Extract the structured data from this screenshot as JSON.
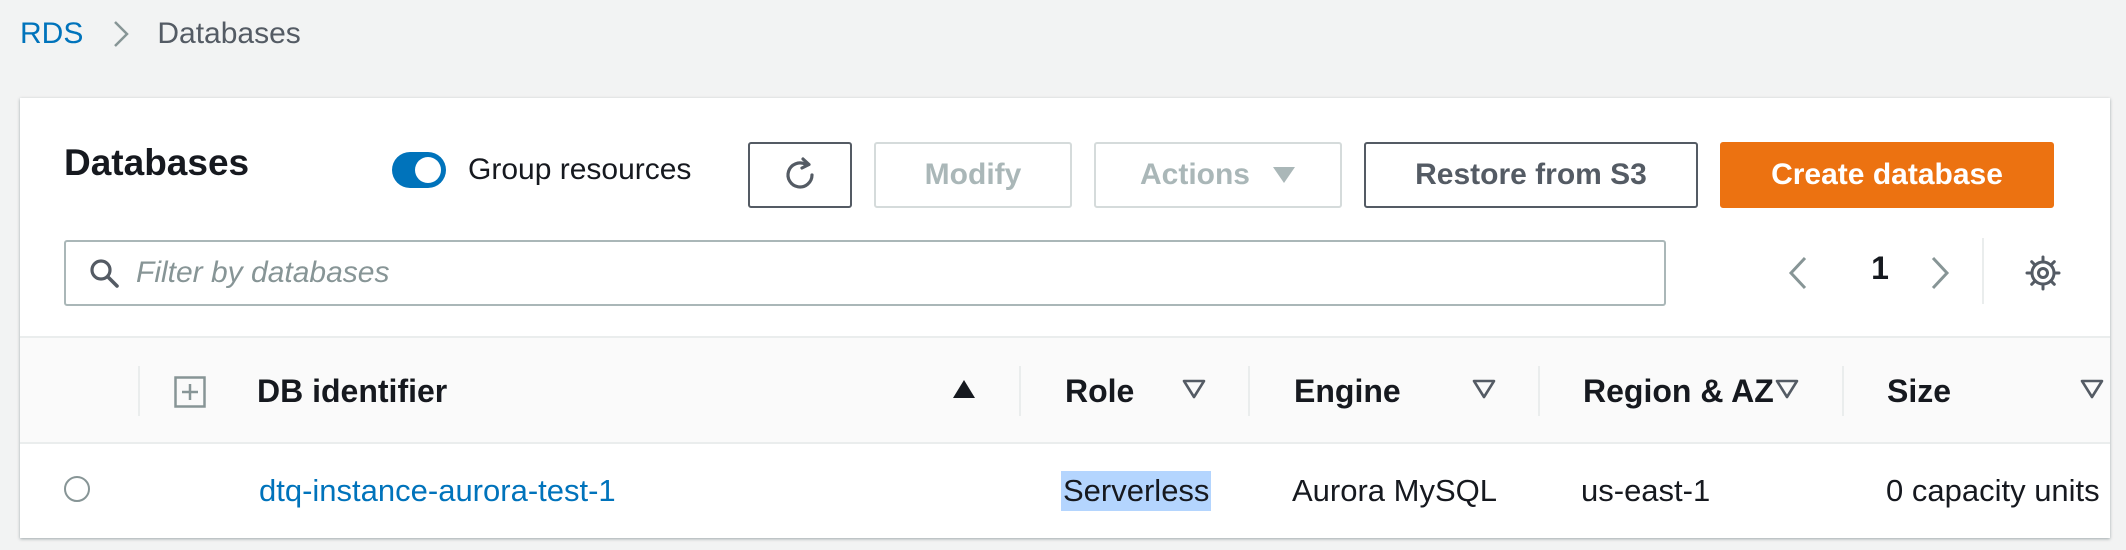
{
  "breadcrumb": {
    "root": "RDS",
    "current": "Databases"
  },
  "panel": {
    "title": "Databases"
  },
  "toolbar": {
    "group_resources_label": "Group resources",
    "group_resources_on": true,
    "modify_label": "Modify",
    "actions_label": "Actions",
    "restore_label": "Restore from S3",
    "create_label": "Create database"
  },
  "filter": {
    "placeholder": "Filter by databases",
    "value": ""
  },
  "pagination": {
    "page": "1"
  },
  "table": {
    "columns": [
      "DB identifier",
      "Role",
      "Engine",
      "Region & AZ",
      "Size"
    ],
    "rows": [
      {
        "identifier": "dtq-instance-aurora-test-1",
        "role": "Serverless",
        "engine": "Aurora MySQL",
        "region": "us-east-1",
        "size": "0 capacity units"
      }
    ]
  },
  "colors": {
    "accent": "#0073bb",
    "primary_button": "#ec7211",
    "selection_highlight": "#b4d5fe"
  },
  "icons": [
    "chevron-right-icon",
    "refresh-icon",
    "caret-down-icon",
    "search-icon",
    "chevron-left-icon",
    "settings-gear-icon",
    "expand-plus-icon",
    "sort-ascending-icon",
    "sort-icon",
    "radio-icon"
  ]
}
